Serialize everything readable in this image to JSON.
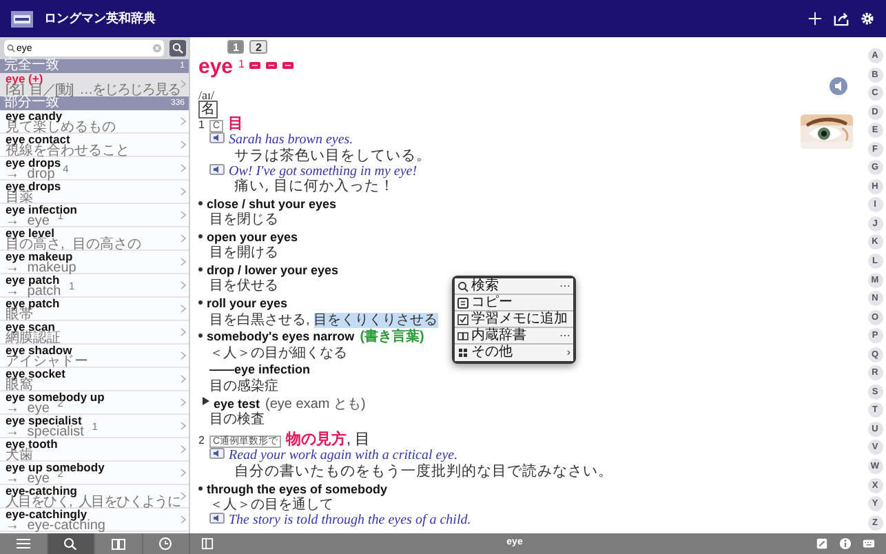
{
  "header": {
    "title": "ロングマン英和辞典"
  },
  "search": {
    "value": "eye"
  },
  "sidebar_sections": [
    {
      "label": "完全一致",
      "count": "1",
      "items": [
        {
          "term": "eye (+)",
          "gloss": "[名] 目／[動] …をじろじろ見る",
          "selected": true
        }
      ]
    },
    {
      "label": "部分一致",
      "count": "336",
      "items": [
        {
          "term": "eye candy",
          "gloss": "見て楽しめるもの",
          "selected": false
        },
        {
          "term": "eye contact",
          "gloss": "視線を合わせること",
          "selected": false
        },
        {
          "term": "eye drops",
          "gloss": "→ drop $^{4}$",
          "selected": false
        },
        {
          "term": "eye drops",
          "gloss": "目薬",
          "selected": false
        },
        {
          "term": "eye infection",
          "gloss": "→ eye $^{1}$",
          "selected": false
        },
        {
          "term": "eye level",
          "gloss": "目の高さ, 目の高さの",
          "selected": false
        },
        {
          "term": "eye makeup",
          "gloss": "→ makeup",
          "selected": false
        },
        {
          "term": "eye patch",
          "gloss": "→ patch $^{1}$",
          "selected": false
        },
        {
          "term": "eye patch",
          "gloss": "眼帯",
          "selected": false
        },
        {
          "term": "eye scan",
          "gloss": "網膜認証",
          "selected": false
        },
        {
          "term": "eye shadow",
          "gloss": "アイシャドー",
          "selected": false
        },
        {
          "term": "eye socket",
          "gloss": "眼窩",
          "selected": false
        },
        {
          "term": "eye somebody up",
          "gloss": "→ eye $^{2}$",
          "selected": false
        },
        {
          "term": "eye specialist",
          "gloss": "→ specialist $^{1}$",
          "selected": false
        },
        {
          "term": "eye tooth",
          "gloss": "犬歯",
          "selected": false
        },
        {
          "term": "eye up somebody",
          "gloss": "→ eye $^{2}$",
          "selected": false
        },
        {
          "term": "eye-catching",
          "gloss": "人目をひく, 人目をひくように",
          "selected": false
        },
        {
          "term": "eye-catchingly",
          "gloss": "→ eye-catching",
          "selected": false
        }
      ]
    }
  ],
  "bottom_tabs": [
    {
      "kind": "list",
      "selected": false
    },
    {
      "kind": "search",
      "selected": true
    },
    {
      "kind": "book",
      "selected": false
    },
    {
      "kind": "clock",
      "selected": false
    }
  ],
  "entry": {
    "page_tabs": [
      {
        "label": "1",
        "selected": true
      },
      {
        "label": "2",
        "selected": false
      }
    ],
    "headword": "eye",
    "homograph": "1",
    "pronunciation": "/aɪ/",
    "pos": "名",
    "blocks": [
      {
        "kind": "sense",
        "number": "1",
        "grammar": "C",
        "gloss": "目"
      },
      {
        "kind": "example",
        "en": "Sarah has brown eyes.",
        "ja": "サラは茶色い目をしている。"
      },
      {
        "kind": "example",
        "en": "Ow! I've got something in my eye!",
        "ja": "痛い, 目に何か入った！"
      },
      {
        "kind": "phrase",
        "en": "close / shut your eyes",
        "ja": "目を閉じる"
      },
      {
        "kind": "phrase",
        "en": "open your eyes",
        "ja": "目を開ける"
      },
      {
        "kind": "phrase",
        "en": "drop / lower your eyes",
        "ja": "目を伏せる"
      },
      {
        "kind": "phrase",
        "en": "roll your eyes",
        "ja": "目を白黒させる, ",
        "ja_selected": "目をくりくりさせる"
      },
      {
        "kind": "phrase",
        "en": "somebody's eyes narrow",
        "note": "(書き言葉)",
        "ja": "＜人＞の目が細くなる"
      },
      {
        "kind": "compound",
        "en": "——eye infection",
        "ja": "目の感染症"
      },
      {
        "kind": "subentry",
        "en": "eye test",
        "note": "(eye exam とも)",
        "ja": "目の検査"
      },
      {
        "kind": "sense",
        "number": "2",
        "grammar": "C通例単数形で",
        "gloss": "物の見方",
        "rest": ", 目"
      },
      {
        "kind": "example",
        "en": "Read your work again with a critical eye.",
        "ja": "自分の書いたものをもう一度批判的な目で読みなさい。"
      },
      {
        "kind": "phrase",
        "en": "through the eyes of somebody",
        "ja": "＜人＞の目を通して"
      },
      {
        "kind": "example",
        "en": "The story is told through the eyes of a child."
      }
    ]
  },
  "context_menu": [
    {
      "kind": "search",
      "label": "検索",
      "trailing": "⋯"
    },
    {
      "kind": "copy",
      "label": "コピー"
    },
    {
      "kind": "check",
      "label": "学習メモに追加"
    },
    {
      "kind": "book",
      "label": "内蔵辞書",
      "trailing": "⋯"
    },
    {
      "kind": "grid",
      "label": "その他",
      "trailing": "›"
    }
  ],
  "index_letters": [
    "A",
    "B",
    "C",
    "D",
    "E",
    "F",
    "G",
    "H",
    "I",
    "J",
    "K",
    "L",
    "M",
    "N",
    "O",
    "P",
    "Q",
    "R",
    "S",
    "T",
    "U",
    "V",
    "W",
    "X",
    "Y",
    "Z"
  ],
  "bottom_bar": {
    "label": "eye"
  }
}
